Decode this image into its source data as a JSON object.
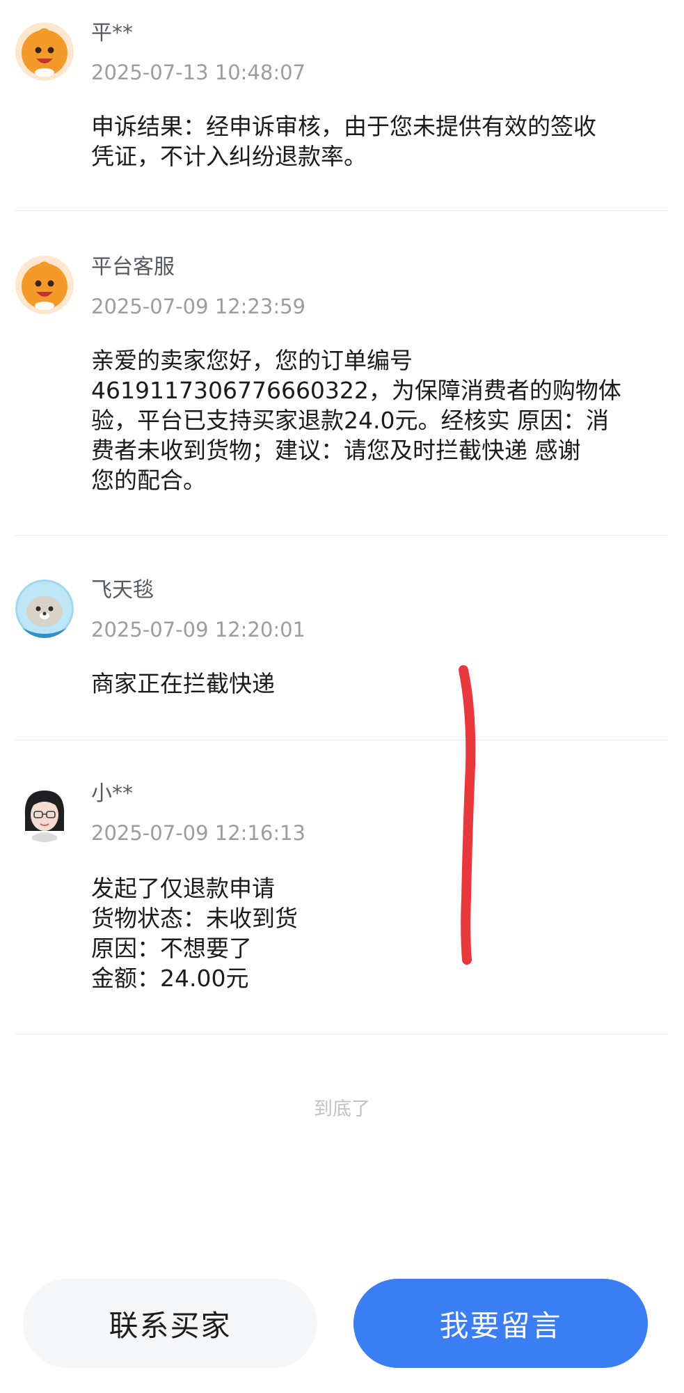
{
  "messages": [
    {
      "name": "平**",
      "time": "2025-07-13 10:48:07",
      "avatar": "mascot-avatar",
      "lines": [
        "申诉结果：经申诉审核，由于您未提供有效的签收",
        "凭证，不计入纠纷退款率。"
      ]
    },
    {
      "name": "平台客服",
      "time": "2025-07-09 12:23:59",
      "avatar": "mascot-avatar",
      "lines": [
        "亲爱的卖家您好，您的订单编号",
        "4619117306776660322，为保障消费者的购物体",
        "验，平台已支持买家退款24.0元。经核实 原因：消",
        "费者未收到货物；建议：请您及时拦截快递  感谢",
        "您的配合。"
      ]
    },
    {
      "name": "飞天毯",
      "time": "2025-07-09 12:20:01",
      "avatar": "seal-avatar",
      "lines": [
        "商家正在拦截快递"
      ]
    },
    {
      "name": "小**",
      "time": "2025-07-09 12:16:13",
      "avatar": "girl-avatar",
      "lines": [
        "发起了仅退款申请",
        "货物状态：未收到货",
        "原因：不想要了",
        "金额：24.00元"
      ]
    }
  ],
  "footer_note": "到底了",
  "buttons": {
    "contact_buyer": "联系买家",
    "leave_message": "我要留言"
  },
  "colors": {
    "primary_button": "#3b7df2",
    "mascot": "#f39a2b",
    "annotation_stroke": "#e8383d"
  }
}
